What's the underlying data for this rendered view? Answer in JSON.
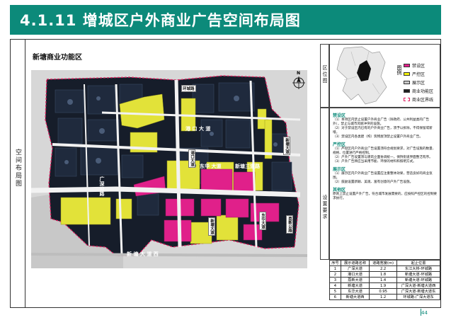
{
  "page": {
    "title": "4.1.11 增城区户外商业广告空间布局图",
    "page_number": "44"
  },
  "left_column_label": "空间布局图",
  "map": {
    "title": "新塘商业功能区",
    "north_label": "N",
    "road_labels": {
      "r1": "新",
      "r2": "塘",
      "r3": "大",
      "r4": "道",
      "r5": "西",
      "r6": "广",
      "r7": "深",
      "r8": "公",
      "r9": "路",
      "r10": "港",
      "r11": "口",
      "r12": "大",
      "r13": "道",
      "r14": "东",
      "r15": "华",
      "r16": "大",
      "r17": "道",
      "r18": "新",
      "r19": "塘",
      "r20": "三",
      "r21": "道",
      "r22": "路"
    },
    "tags": {
      "t1": "环城路",
      "t2": "港口大道",
      "t3": "新塘大道",
      "t4": "东华大道",
      "t5": "荔新公路",
      "t6": "新塘大道"
    }
  },
  "location": {
    "label": "区位图",
    "legend_title": "图例",
    "legend": [
      {
        "label": "禁设区",
        "color": "#e0208a"
      },
      {
        "label": "严控区",
        "color": "#f2f20a"
      },
      {
        "label": "展示区",
        "color": "#c9c9c9"
      },
      {
        "label": "商业功能区",
        "color": "#222222"
      },
      {
        "label": "商业区界线",
        "color": "#ffffff"
      }
    ]
  },
  "requirements": {
    "label": "设置要求",
    "sections": [
      {
        "head": "禁设区",
        "paras": [
          "（1）本项区内禁止设置户外商业广告（除政府、公共利益类的广告外），禁止与城市风貌冲突的设施。",
          "（2）对于禁设区内已有的户外商业广告，须予以拆除，不得保留或新增。",
          "（3）禁设区内各类建（构）筑物屋顶禁止设置户外商业广告。"
        ]
      },
      {
        "head": "严控区",
        "paras": [
          "（1）严控区内户外商业广告设置须符合规划要求，对广告设施的数量、规格、位置进行严格控制。",
          "（2）户外广告设置须与建筑立面协调统一，保持街道界面整洁有序。",
          "（3）户外广告牌应当采用节能、环保的材料和照明方式。"
        ]
      },
      {
        "head": "展示区",
        "paras": [
          "（1）展示区内户外商业广告设置应注重整体效果，营造良好的商业氛围。",
          "（2）鼓励设置新颖、美观、富有创意的户外广告设施。"
        ]
      },
      {
        "head": "其他区",
        "paras": [
          "原则上禁止设置户外广告，符合城市发展需要的，应按照严控区的控制要求执行。"
        ]
      }
    ]
  },
  "table": {
    "headers": [
      "序号",
      "展示道路名称",
      "道路宽度(m)",
      "起止位置"
    ],
    "rows": [
      [
        "1",
        "广深大道",
        "2.2",
        "东江大桥-环城路"
      ],
      [
        "2",
        "港口大道",
        "1.8",
        "新塘大道-环城路"
      ],
      [
        "3",
        "荔新大道",
        "1.4",
        "新塘大道-环城路"
      ],
      [
        "4",
        "新塘大道",
        "1.9",
        "广深大道-新塘大道西"
      ],
      [
        "5",
        "东华大道",
        "0.95",
        "广深大道-新塘大道东"
      ],
      [
        "6",
        "新塘大道西",
        "1.2",
        "环城路-广深大道东"
      ]
    ]
  }
}
